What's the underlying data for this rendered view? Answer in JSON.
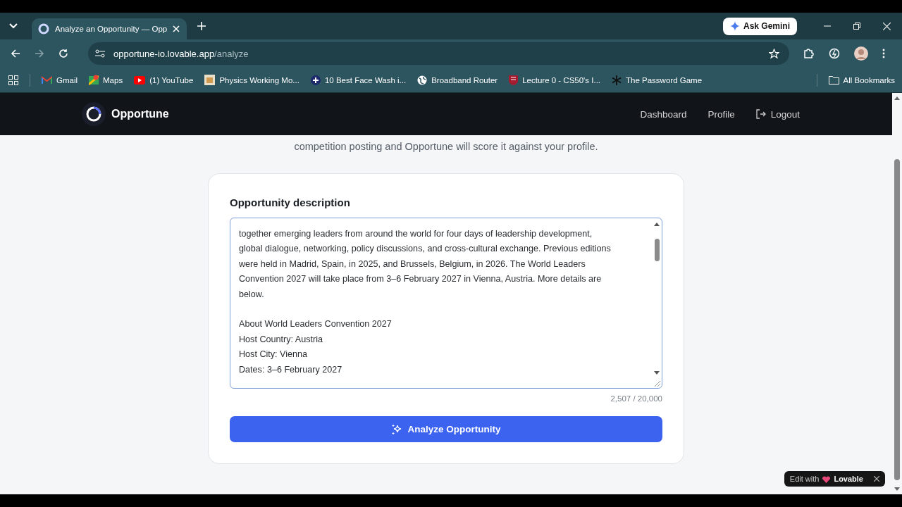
{
  "browser": {
    "tabs": [
      {
        "title": "Analyze an Opportunity — Opp",
        "selected": true
      }
    ],
    "ask_button": "Ask Gemini",
    "address": {
      "host": "opportune-io.lovable.app",
      "path": "/analyze"
    },
    "bookmarks": [
      {
        "label": "Gmail",
        "kind": "gmail"
      },
      {
        "label": "Maps",
        "kind": "maps"
      },
      {
        "label": "(1) YouTube",
        "kind": "youtube"
      },
      {
        "label": "Physics Working Mo...",
        "kind": "page"
      },
      {
        "label": "10 Best Face Wash i...",
        "kind": "plus"
      },
      {
        "label": "Broadband Router",
        "kind": "globe"
      },
      {
        "label": "Lecture 0 - CS50's I...",
        "kind": "shield"
      },
      {
        "label": "The Password Game",
        "kind": "star"
      }
    ],
    "all_bookmarks": "All Bookmarks"
  },
  "header": {
    "brand": "Opportune",
    "nav": [
      {
        "label": "Dashboard",
        "kind": "link"
      },
      {
        "label": "Profile",
        "kind": "link"
      },
      {
        "label": "Logout",
        "kind": "logout"
      }
    ]
  },
  "intro": "competition posting and Opportune will score it against your profile.",
  "card": {
    "label": "Opportunity description",
    "paragraph_lines": [
      "together emerging leaders from around the world for four days of leadership development,",
      "global dialogue, networking, policy discussions, and cross-cultural exchange. Previous editions",
      "were held in Madrid, Spain, in 2025, and Brussels, Belgium, in 2026. The World Leaders",
      "Convention 2027 will take place from 3–6 February 2027 in Vienna, Austria. More details are",
      "below."
    ],
    "detail_lines": [
      "About World Leaders Convention 2027",
      "Host Country: Austria",
      "Host City: Vienna",
      "Dates: 3–6 February 2027"
    ],
    "counter": "2,507 / 20,000",
    "button": "Analyze Opportunity"
  },
  "badge": {
    "prefix": "Edit with",
    "brand": "Lovable"
  }
}
